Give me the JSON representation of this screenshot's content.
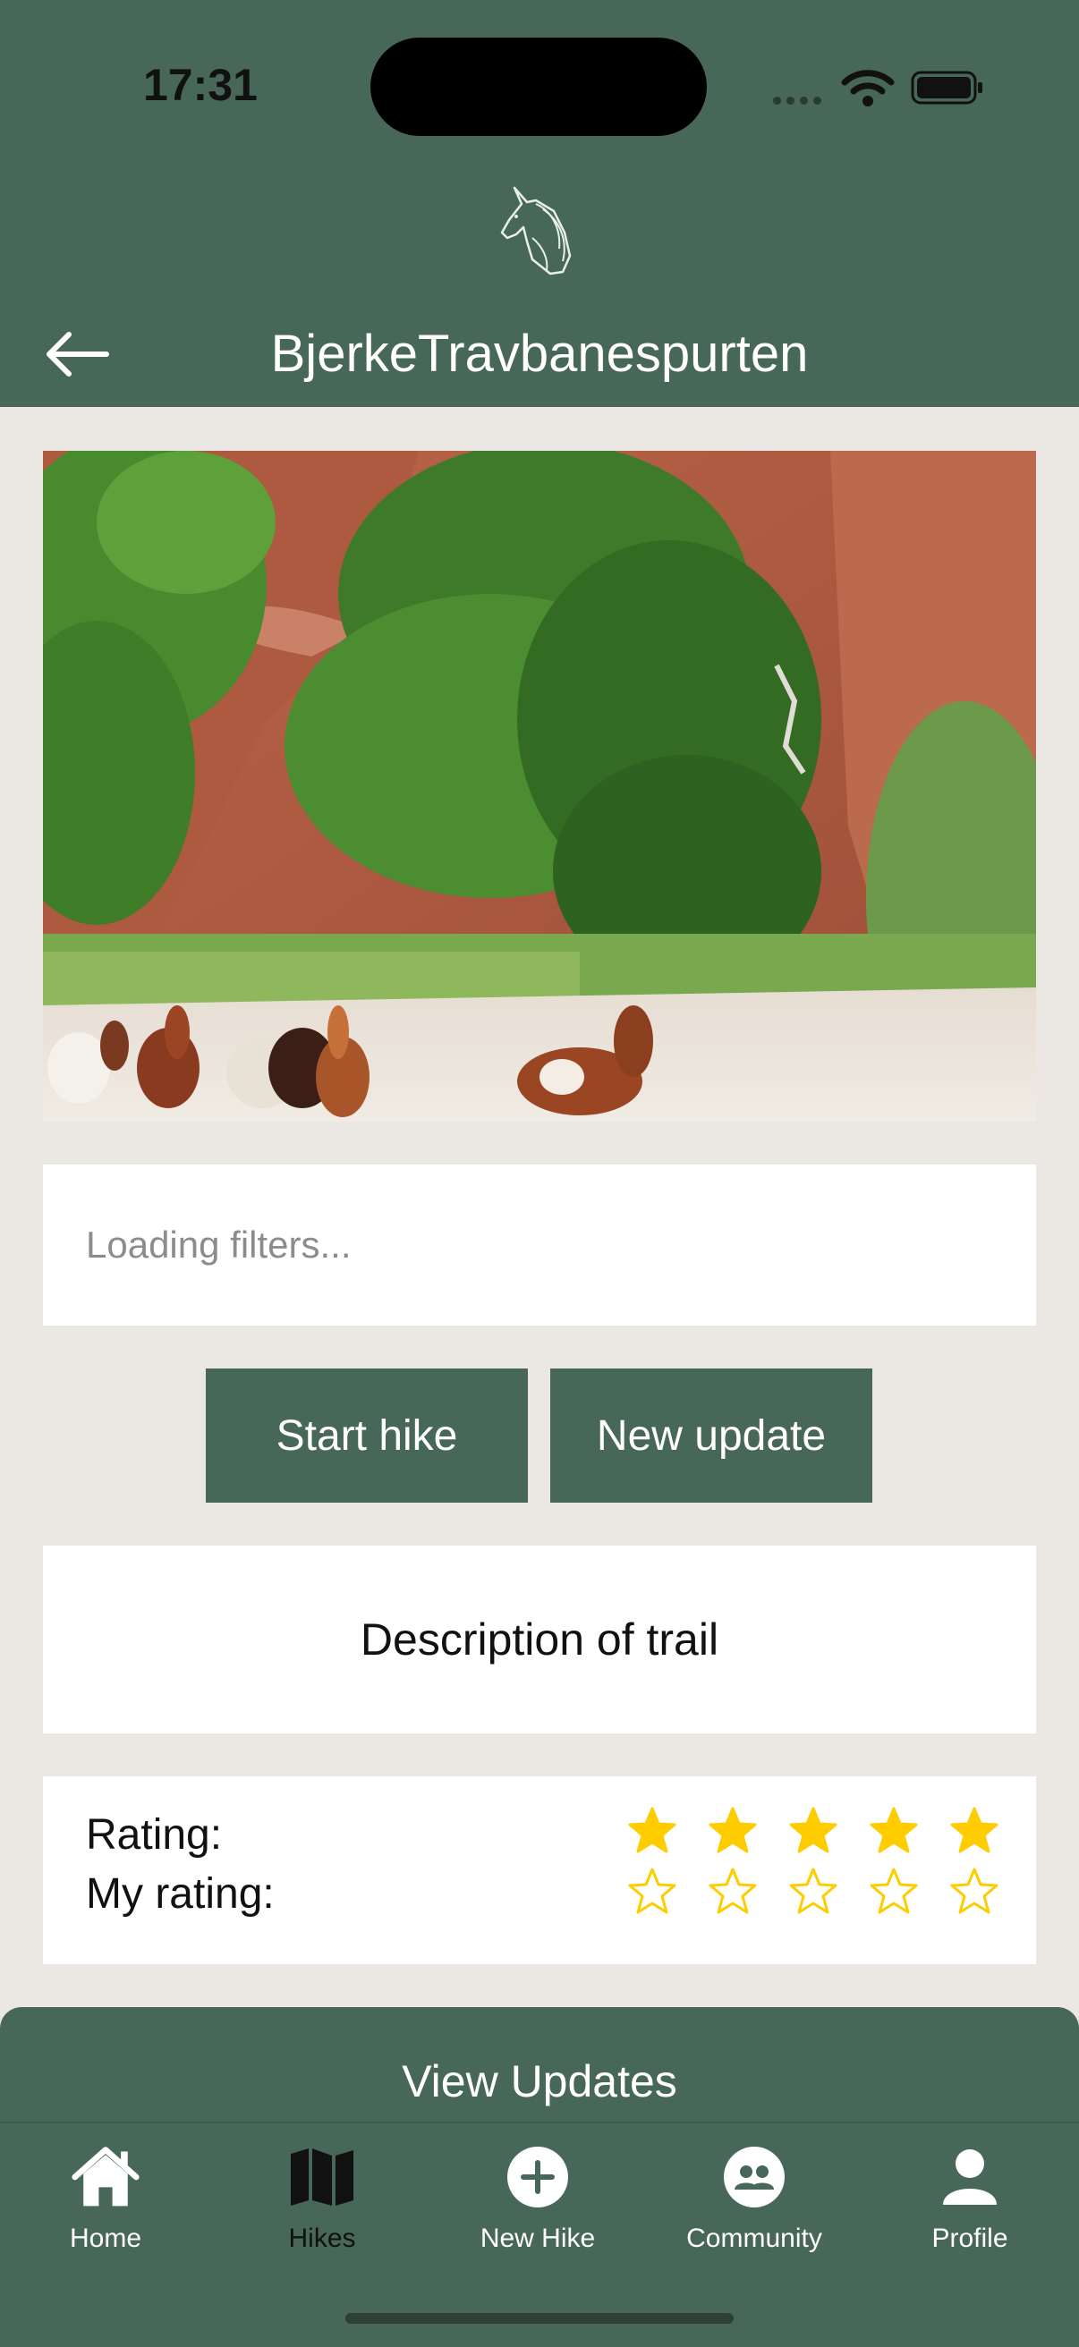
{
  "status_bar": {
    "time": "17:31"
  },
  "header": {
    "title": "BjerkeTravbanespurten"
  },
  "filters": {
    "placeholder": "Loading filters..."
  },
  "actions": {
    "start_hike": "Start hike",
    "new_update": "New update"
  },
  "description": {
    "text": "Description of trail"
  },
  "rating": {
    "rating_label": "Rating:",
    "my_rating_label": "My rating:",
    "rating_value": 5,
    "rating_max": 5,
    "my_rating_value": 0,
    "star_color": "#FFCC00"
  },
  "updates": {
    "label": "View Updates"
  },
  "tabbar": {
    "tabs": [
      {
        "label": "Home",
        "icon": "home-icon"
      },
      {
        "label": "Hikes",
        "icon": "map-icon"
      },
      {
        "label": "New Hike",
        "icon": "plus-circle-icon"
      },
      {
        "label": "Community",
        "icon": "people-icon"
      },
      {
        "label": "Profile",
        "icon": "person-icon"
      }
    ],
    "active": "Hikes"
  },
  "colors": {
    "brand": "#476858",
    "background": "#EBE7E2"
  }
}
